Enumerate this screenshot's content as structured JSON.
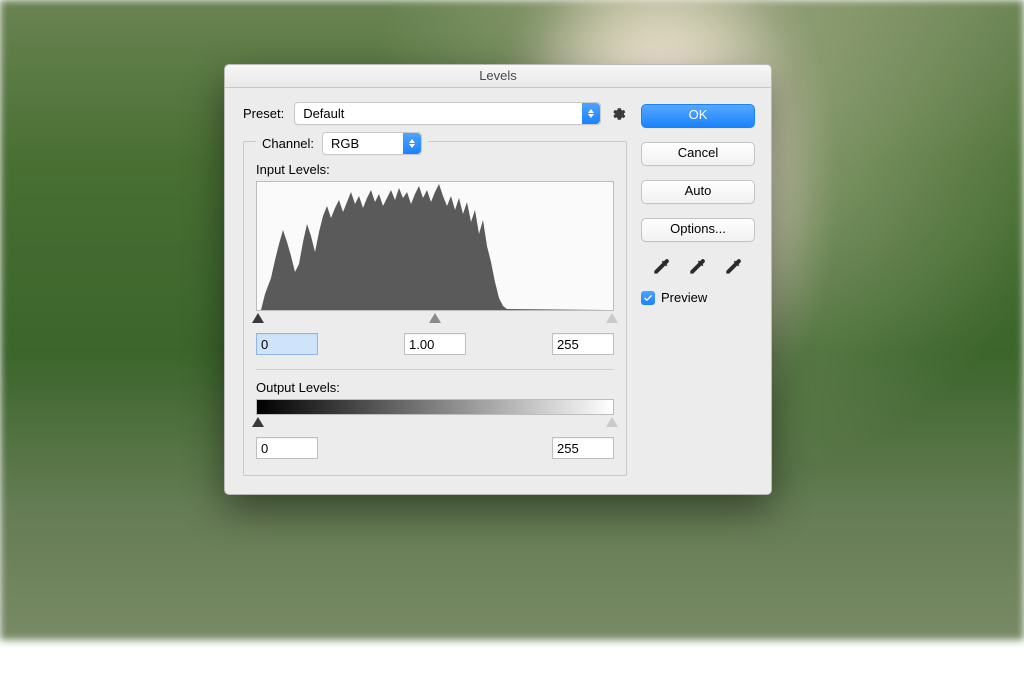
{
  "dialog": {
    "title": "Levels",
    "preset_label": "Preset:",
    "preset_value": "Default",
    "channel_label": "Channel:",
    "channel_value": "RGB",
    "input_levels_label": "Input Levels:",
    "output_levels_label": "Output Levels:",
    "input_black": "0",
    "input_gamma": "1.00",
    "input_white": "255",
    "output_black": "0",
    "output_white": "255"
  },
  "buttons": {
    "ok": "OK",
    "cancel": "Cancel",
    "auto": "Auto",
    "options": "Options..."
  },
  "preview": {
    "label": "Preview",
    "checked": true
  }
}
